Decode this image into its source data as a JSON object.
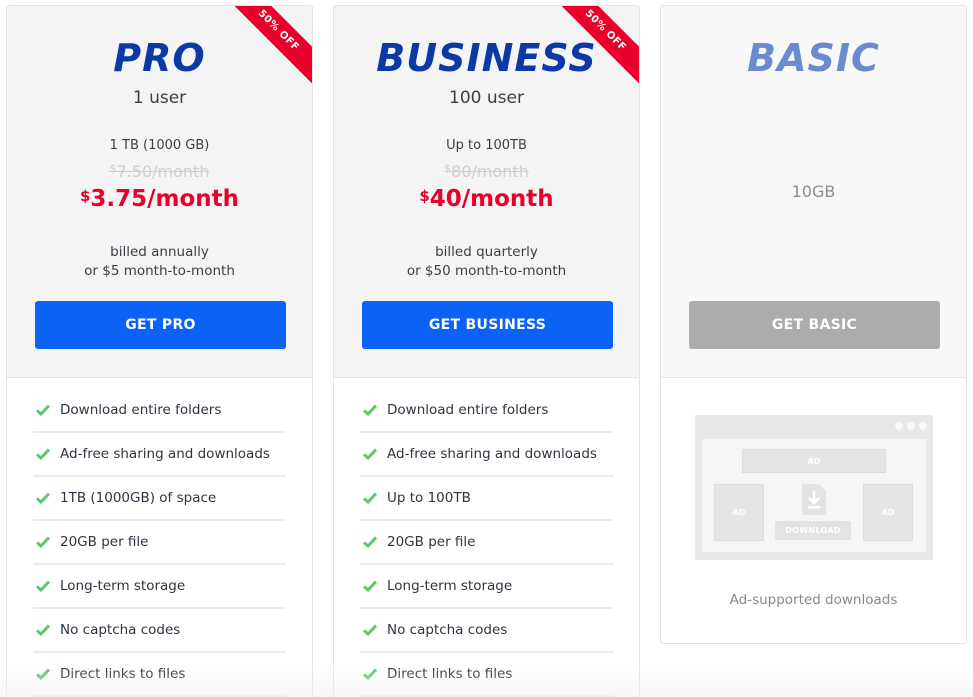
{
  "plans": {
    "pro": {
      "name": "PRO",
      "users": "1 user",
      "storage": "1 TB (1000 GB)",
      "old_price_currency": "$",
      "old_price": "7.50/month",
      "new_price_currency": "$",
      "new_price": "3.75/month",
      "billing_line1": "billed annually",
      "billing_line2": "or $5 month-to-month",
      "cta_label": "GET PRO",
      "ribbon": "50% OFF",
      "features": [
        "Download entire folders",
        "Ad-free sharing and downloads",
        "1TB (1000GB) of space",
        "20GB per file",
        "Long-term storage",
        "No captcha codes",
        "Direct links to files"
      ]
    },
    "business": {
      "name": "BUSINESS",
      "users": "100 user",
      "storage": "Up to 100TB",
      "old_price_currency": "$",
      "old_price": "80/month",
      "new_price_currency": "$",
      "new_price": "40/month",
      "billing_line1": "billed quarterly",
      "billing_line2": "or $50 month-to-month",
      "cta_label": "GET BUSINESS",
      "ribbon": "50% OFF",
      "features": [
        "Download entire folders",
        "Ad-free sharing and downloads",
        "Up to 100TB",
        "20GB per file",
        "Long-term storage",
        "No captcha codes",
        "Direct links to files"
      ]
    },
    "basic": {
      "name": "BASIC",
      "storage": "10GB",
      "cta_label": "GET BASIC",
      "illustration": {
        "ad_label": "AD",
        "download_label": "DOWNLOAD"
      },
      "caption": "Ad-supported downloads"
    }
  },
  "colors": {
    "plan_name": "#0b3aa7",
    "basic_name": "#6a8ccf",
    "price_red": "#e8002a",
    "cta_blue": "#0a63f5",
    "cta_gray": "#acacac",
    "check_green": "#5cc96a",
    "ribbon_red": "#e8002a"
  }
}
